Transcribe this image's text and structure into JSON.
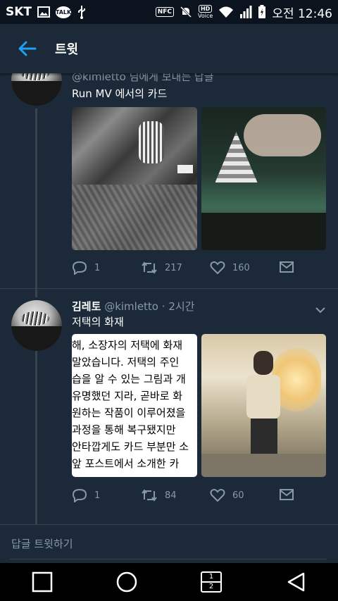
{
  "status_bar": {
    "carrier": "SKT",
    "talk_label": "TALK",
    "nfc_label": "NFC",
    "hd_label": "HD",
    "voice_label": "Voice",
    "time": "오전 12:46"
  },
  "header": {
    "title": "트윗"
  },
  "tweets": [
    {
      "reply_to": "@kimletto 님에게 보내는 답글",
      "text": "Run MV 에서의 카드",
      "replies": "1",
      "retweets": "217",
      "likes": "160"
    },
    {
      "name": "김레토",
      "handle": "@kimletto",
      "time": "· 2시간",
      "text": "저택의 화재",
      "replies": "1",
      "retweets": "84",
      "likes": "60",
      "doc_lines": [
        "해, 소장자의 저택에 화재",
        " 말았습니다. 저택의 주인",
        "습을 알 수 있는 그림과 개",
        " 유명했던 지라, 곧바로 화",
        "원하는 작품이 이루어졌을",
        " 과정을 통해 복구됐지만",
        "안타깝게도 카드 부분만 소",
        " 앞 포스트에서 소개한 카"
      ]
    }
  ],
  "reply_bar": {
    "placeholder": "답글 트윗하기"
  },
  "nav_bar": {
    "page_indicator_top": "1",
    "page_indicator_bottom": "2"
  },
  "colors": {
    "background": "#1c2938",
    "accent": "#1da1f2",
    "muted": "#8899a6"
  }
}
